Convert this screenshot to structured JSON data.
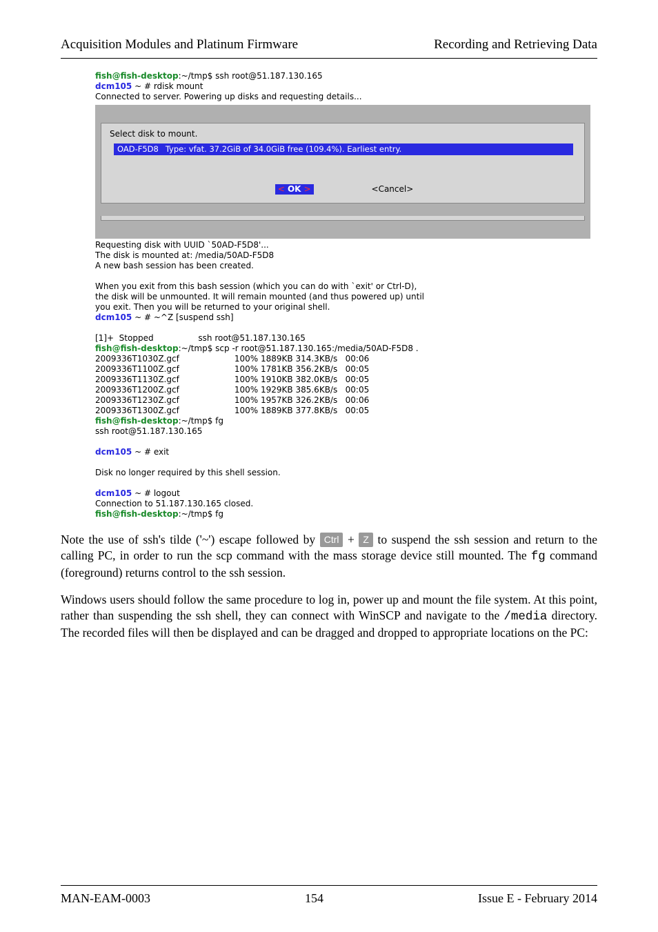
{
  "header": {
    "left": "Acquisition Modules and Platinum Firmware",
    "right": "Recording and Retrieving Data"
  },
  "terminal": {
    "prompt1_host": "fish@fish-desktop",
    "prompt1_path": ":~/tmp$",
    "cmd_ssh": " ssh root@51.187.130.165",
    "dcm_prompt": "dcm105",
    "dcm_prompt_suffix": " ~ # ",
    "cmd_rdisk": "rdisk mount",
    "connected": "Connected to server. Powering up disks and requesting details...",
    "select_label": "Select disk to mount.",
    "uuid": "OAD-F5D8",
    "uuid_desc": "Type: vfat. 37.2GiB of 34.0GiB free (109.4%). Earliest entry.",
    "ok_lt": "<",
    "ok_label": " OK ",
    "ok_gt": ">",
    "cancel_label": "<Cancel>",
    "post_dialog_1": "Requesting disk with UUID `50AD-F5D8'...",
    "post_dialog_2": "The disk is mounted at: /media/50AD-F5D8",
    "post_dialog_3": "A new bash session has been created.",
    "explain_1": "When you exit from this bash session (which you can do with `exit' or Ctrl-D),",
    "explain_2": "the disk will be unmounted. It will remain mounted (and thus powered up) until",
    "explain_3": "you exit. Then you will be returned to your original shell.",
    "suspend": " ~^Z [suspend ssh]",
    "stopped_line": "[1]+  Stopped                 ssh root@51.187.130.165",
    "scp_prompt_path": ":~/tmp$",
    "scp_cmd": " scp -r root@51.187.130.165:/media/50AD-F5D8 .",
    "scp_rows": [
      "2009336T1030Z.gcf                     100% 1889KB 314.3KB/s   00:06",
      "2009336T1100Z.gcf                     100% 1781KB 356.2KB/s   00:05",
      "2009336T1130Z.gcf                     100% 1910KB 382.0KB/s   00:05",
      "2009336T1200Z.gcf                     100% 1929KB 385.6KB/s   00:05",
      "2009336T1230Z.gcf                     100% 1957KB 326.2KB/s   00:06",
      "2009336T1300Z.gcf                     100% 1889KB 377.8KB/s   00:05"
    ],
    "fg_cmd": " fg",
    "ssh_resume": "ssh root@51.187.130.165",
    "exit_cmd": "exit",
    "disk_done": "Disk no longer required by this shell session.",
    "logout_cmd": "logout",
    "conn_closed": "Connection to 51.187.130.165 closed."
  },
  "body": {
    "p1_a": "Note the use of ssh's tilde ('~') escape followed by ",
    "kbd_ctrl": "Ctrl",
    "plus": " + ",
    "kbd_z": "Z",
    "p1_b": " to suspend the ssh session and return to the calling PC, in order to run the scp command with the mass storage device still mounted.  The ",
    "mono_fg": "fg",
    "p1_c": " command (foreground) returns control to the ssh session.",
    "p2_a": "Windows users should follow the same procedure to log in, power up and mount the file system.  At this point, rather than suspending the ssh shell, they can connect with WinSCP and navigate to the ",
    "mono_media": "/media",
    "p2_b": " directory.  The recorded files will then be displayed and can be dragged and dropped to appropriate locations on the PC:"
  },
  "footer": {
    "left": "MAN-EAM-0003",
    "center": "154",
    "right": "Issue E  - February 2014"
  }
}
